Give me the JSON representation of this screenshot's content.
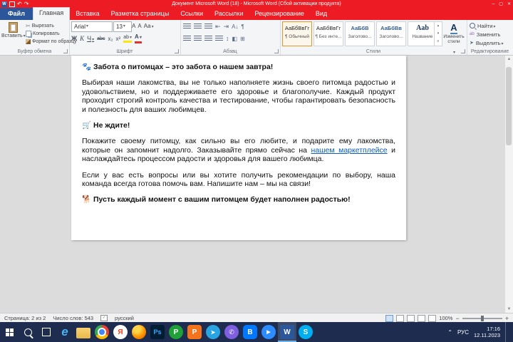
{
  "colors": {
    "titlebar_red": "#ed1c24",
    "file_tab_blue": "#2b579a",
    "link_blue": "#0a5bc4",
    "taskbar_navy": "#1d2c4f",
    "selected_style_orange": "#e0962e",
    "word_blue": "#2b579a"
  },
  "title_bar": {
    "title": "Документ Microsoft Word (18)  - Microsoft Word (Сбой активации продукта)"
  },
  "tabs": [
    {
      "label": "Файл"
    },
    {
      "label": "Главная"
    },
    {
      "label": "Вставка"
    },
    {
      "label": "Разметка страницы"
    },
    {
      "label": "Ссылки"
    },
    {
      "label": "Рассылки"
    },
    {
      "label": "Рецензирование"
    },
    {
      "label": "Вид"
    }
  ],
  "ribbon": {
    "clipboard": {
      "group_label": "Буфер обмена",
      "paste": "Вставить",
      "cut": "Вырезать",
      "copy": "Копировать",
      "format_painter": "Формат по образцу"
    },
    "font": {
      "group_label": "Шрифт",
      "family": "Arial",
      "size": "13",
      "grow": "А",
      "shrink": "А",
      "case": "Аа",
      "bold": "Ж",
      "italic": "К",
      "underline": "Ч",
      "strike": "abc",
      "subscript": "x₂",
      "superscript": "x²",
      "highlight": "ab",
      "color": "А"
    },
    "paragraph": {
      "group_label": "Абзац",
      "sort": "А↓",
      "pilcrow": "¶"
    },
    "styles": {
      "group_label": "Стили",
      "change_icon": "А",
      "change_styles": "Изменить стили",
      "gallery": [
        {
          "preview": "АаБбВвГг",
          "name": "¶ Обычный"
        },
        {
          "preview": "АаБбВвГг",
          "name": "¶ Без инте..."
        },
        {
          "preview": "АаБбВ",
          "name": "Заголово..."
        },
        {
          "preview": "АаБбВв",
          "name": "Заголово..."
        },
        {
          "preview": "Aab",
          "name": "Название"
        }
      ]
    },
    "editing": {
      "group_label": "Редактирование",
      "find": "Найти",
      "replace": "Заменить",
      "select": "Выделить"
    }
  },
  "document": {
    "heading_intro": "🐾 Забота о питомцах – это забота о нашем завтра!",
    "para_quality": "Выбирая наши лакомства, вы не только наполняете жизнь своего питомца радостью и удовольствием, но и поддерживаете его здоровье и благополучие. Каждый продукт проходит строгий контроль качества и тестирование, чтобы гарантировать безопасность и полезность для ваших любимцев.",
    "heading_cta": "🛒 Не ждите!",
    "para_cta_before": "Покажите своему питомцу, как сильно вы его любите, и подарите ему лакомства, которые он запомнит надолго. Заказывайте прямо сейчас на ",
    "link_marketplace": "нашем маркетплейсе",
    "para_cta_after": " и наслаждайтесь процессом радости и здоровья для вашего любимца.",
    "para_support": "Если у вас есть вопросы или вы хотите получить рекомендации по выбору, наша команда всегда готова помочь вам. Напишите нам – мы на связи!",
    "heading_final": "🐕 Пусть каждый момент с вашим питомцем будет наполнен радостью!"
  },
  "status_bar": {
    "page": "Страница: 2 из 2",
    "words": "Число слов: 543",
    "language": "русский",
    "zoom": "100%",
    "zoom_out": "−",
    "zoom_in": "+"
  },
  "taskbar": {
    "icons": [
      {
        "name": "edge",
        "glyph": "e"
      },
      {
        "name": "explorer",
        "glyph": ""
      },
      {
        "name": "chrome",
        "glyph": ""
      },
      {
        "name": "yandex-browser",
        "glyph": "Я"
      },
      {
        "name": "firefox",
        "glyph": ""
      },
      {
        "name": "photoshop",
        "glyph": "Ps"
      },
      {
        "name": "app-green-p",
        "glyph": "P"
      },
      {
        "name": "app-orange-p",
        "glyph": "P"
      },
      {
        "name": "telegram",
        "glyph": "➤"
      },
      {
        "name": "viber",
        "glyph": "✆"
      },
      {
        "name": "vk",
        "glyph": "B"
      },
      {
        "name": "zoom",
        "glyph": "▶"
      },
      {
        "name": "word",
        "glyph": "W"
      },
      {
        "name": "skype",
        "glyph": "S"
      }
    ],
    "tray": {
      "language": "РУС",
      "time": "17:16",
      "date": "12.11.2023"
    }
  }
}
